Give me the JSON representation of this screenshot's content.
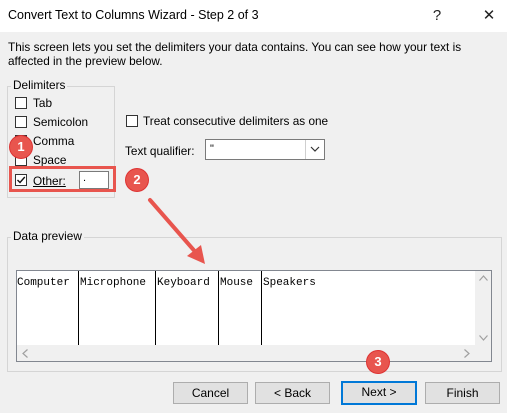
{
  "window": {
    "title": "Convert Text to Columns Wizard - Step 2 of 3",
    "help_label": "?",
    "close_label": "✕"
  },
  "intro_text": "This screen lets you set the delimiters your data contains.  You can see how your text is affected in the preview below.",
  "delimiters": {
    "legend": "Delimiters",
    "options": [
      {
        "label": "Tab",
        "checked": false
      },
      {
        "label": "Semicolon",
        "checked": false
      },
      {
        "label": "Comma",
        "checked": false
      },
      {
        "label": "Space",
        "checked": false
      },
      {
        "label": "Other:",
        "checked": true
      }
    ],
    "other_value": "."
  },
  "consecutive": {
    "label": "Treat consecutive delimiters as one",
    "checked": false
  },
  "qualifier": {
    "label": "Text qualifier:",
    "value": "\""
  },
  "preview": {
    "legend": "Data preview",
    "columns": [
      "Computer",
      "Microphone",
      "Keyboard",
      "Mouse",
      "Speakers"
    ]
  },
  "buttons": {
    "cancel": "Cancel",
    "back": "< Back",
    "next": "Next >",
    "finish": "Finish"
  },
  "callouts": [
    "1",
    "2",
    "3"
  ],
  "colors": {
    "accent": "#0078d7",
    "callout": "#e8554e"
  }
}
